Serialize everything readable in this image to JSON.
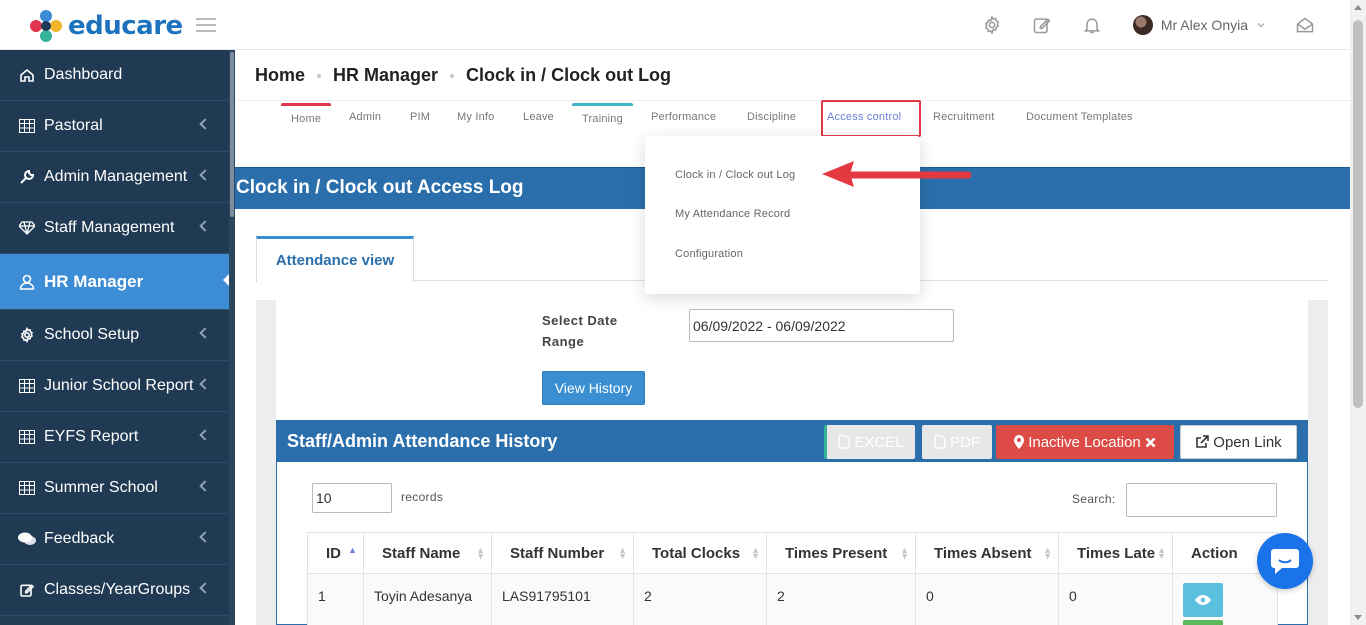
{
  "app": {
    "name": "educare"
  },
  "header": {
    "user_name": "Mr Alex Onyia",
    "icons": [
      "gear-icon",
      "edit-icon",
      "bell-icon",
      "inbox-icon"
    ]
  },
  "sidebar": {
    "items": [
      {
        "label": "Dashboard",
        "icon": "home-icon"
      },
      {
        "label": "Pastoral",
        "icon": "table-icon"
      },
      {
        "label": "Admin Management",
        "icon": "wrench-icon"
      },
      {
        "label": "Staff Management",
        "icon": "diamond-icon"
      },
      {
        "label": "HR Manager",
        "icon": "user-icon"
      },
      {
        "label": "School Setup",
        "icon": "gear-icon"
      },
      {
        "label": "Junior School Report",
        "icon": "table-icon"
      },
      {
        "label": "EYFS Report",
        "icon": "table-icon"
      },
      {
        "label": "Summer School",
        "icon": "table-icon"
      },
      {
        "label": "Feedback",
        "icon": "comments-icon"
      },
      {
        "label": "Classes/YearGroups",
        "icon": "edit-icon"
      }
    ]
  },
  "breadcrumb": [
    "Home",
    "HR Manager",
    "Clock in / Clock out Log"
  ],
  "nav_tabs": [
    "Home",
    "Admin",
    "PIM",
    "My Info",
    "Leave",
    "Training",
    "Performance",
    "Discipline",
    "Access control",
    "Recruitment",
    "Document Templates"
  ],
  "dropdown": {
    "items": [
      "Clock in / Clock out Log",
      "My Attendance Record",
      "Configuration"
    ]
  },
  "page": {
    "title": "Clock in / Clock out Access Log",
    "tab": "Attendance view"
  },
  "filter": {
    "date_label": "Select Date Range",
    "date_value": "06/09/2022 - 06/09/2022",
    "view_button": "View History"
  },
  "history": {
    "title": "Staff/Admin Attendance History",
    "buttons": {
      "excel": "EXCEL",
      "pdf": "PDF",
      "inactive": "Inactive Location",
      "open": "Open Link"
    },
    "page_length": "10",
    "records_label": "records",
    "search_label": "Search:",
    "columns": [
      "ID",
      "Staff Name",
      "Staff Number",
      "Total Clocks",
      "Times Present",
      "Times Absent",
      "Times Late",
      "Action"
    ],
    "rows": [
      {
        "id": "1",
        "staff_name": "Toyin Adesanya",
        "staff_number": "LAS91795101",
        "total_clocks": "2",
        "times_present": "2",
        "times_absent": "0",
        "times_late": "0"
      }
    ]
  },
  "colors": {
    "sidebar_bg": "#233d55",
    "active": "#3c8dd5",
    "primary_blue": "#2a6fab",
    "danger": "#dc4b45",
    "highlight_red": "#e03a43"
  }
}
